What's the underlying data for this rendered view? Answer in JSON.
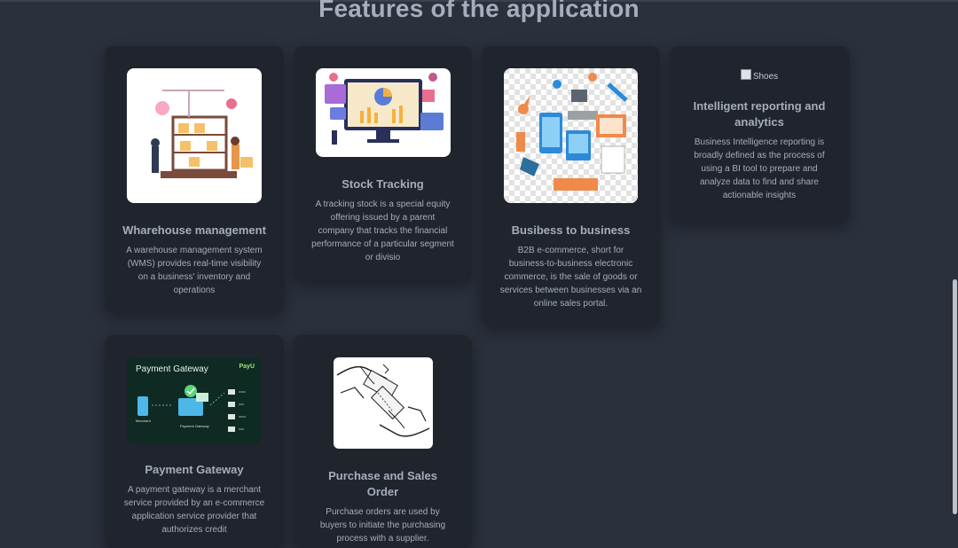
{
  "page": {
    "title": "Features of the application"
  },
  "cards": [
    {
      "title": "Wharehouse management",
      "description": "A warehouse management system (WMS) provides real-time visibility on a business' inventory and operations",
      "image_icon": "warehouse-illustration"
    },
    {
      "title": "Stock Tracking",
      "description": "A tracking stock is a special equity offering issued by a parent company that tracks the financial performance of a particular segment or divisio",
      "image_icon": "stock-dashboard-illustration"
    },
    {
      "title": "Busibess to business",
      "description": "B2B e-commerce, short for business-to-business electronic commerce, is the sale of goods or services between businesses via an online sales portal.",
      "image_icon": "ecommerce-illustration"
    },
    {
      "title": "Intelligent reporting and analytics",
      "description": "Business Intelligence reporting is broadly defined as the process of using a BI tool to prepare and analyze data to find and share actionable insights",
      "image_alt": "Shoes"
    },
    {
      "title": "Payment Gateway",
      "description": "A payment gateway is a merchant service provided by an e-commerce application service provider that authorizes credit",
      "image_icon": "payment-gateway-diagram",
      "image_header": "Payment Gateway",
      "image_brand": "PayU",
      "image_left_label": "Merchant",
      "image_center_label": "Payment Gateway"
    },
    {
      "title": "Purchase and Sales Order",
      "description": "Purchase orders are used by buyers to initiate the purchasing process with a supplier.",
      "image_icon": "handshake-money-sketch"
    }
  ],
  "colors": {
    "background": "#2a303c",
    "card": "#1f242d",
    "text": "#a6adbb"
  }
}
